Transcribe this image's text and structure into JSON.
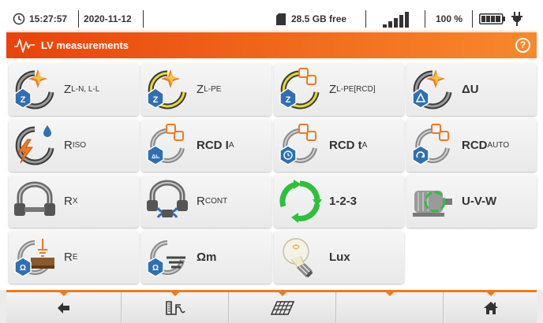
{
  "status": {
    "time": "15:27:57",
    "date": "2020-11-12",
    "storage": "28.5 GB free",
    "signal_bars": 5,
    "battery": "100 %",
    "icons": [
      "clock-icon",
      "sd-card-icon",
      "signal-icon",
      "battery-icon",
      "power-plug-icon"
    ]
  },
  "titlebar": {
    "title": "LV measurements",
    "help": "?",
    "icons": [
      "waveform-icon",
      "help-icon"
    ]
  },
  "tiles": [
    {
      "main": "Z",
      "sub": "L-N, L-L",
      "bold": false
    },
    {
      "main": "Z",
      "sub": "L-PE",
      "bold": false
    },
    {
      "main": "Z",
      "sub": "L-PE[RCD]",
      "bold": false
    },
    {
      "main": "ΔU",
      "sub": "",
      "bold": true
    },
    {
      "main": "R",
      "sub": "ISO",
      "bold": false
    },
    {
      "main": "RCD I",
      "sub": "A",
      "bold": true
    },
    {
      "main": "RCD t",
      "sub": "A",
      "bold": true
    },
    {
      "main": "RCD",
      "sub": "AUTO",
      "bold": true
    },
    {
      "main": "R",
      "sub": "X",
      "bold": false
    },
    {
      "main": "R",
      "sub": "CONT",
      "bold": false
    },
    {
      "main": "1-2-3",
      "sub": "",
      "bold": true
    },
    {
      "main": "U-V-W",
      "sub": "",
      "bold": true
    },
    {
      "main": "R",
      "sub": "E",
      "bold": false
    },
    {
      "main": "Ωm",
      "sub": "",
      "bold": true
    },
    {
      "main": "Lux",
      "sub": "",
      "bold": true
    }
  ],
  "bottombar": {
    "buttons": [
      "back-arrow-icon",
      "oscillogram-icon",
      "solar-panel-icon",
      "empty",
      "home-icon"
    ]
  },
  "colors": {
    "accent": "#f07a1e",
    "title_start": "#e9430b",
    "title_end": "#f7892c",
    "icon_blue": "#2f6fb6",
    "icon_orange": "#f07a1e",
    "text": "#333333"
  }
}
